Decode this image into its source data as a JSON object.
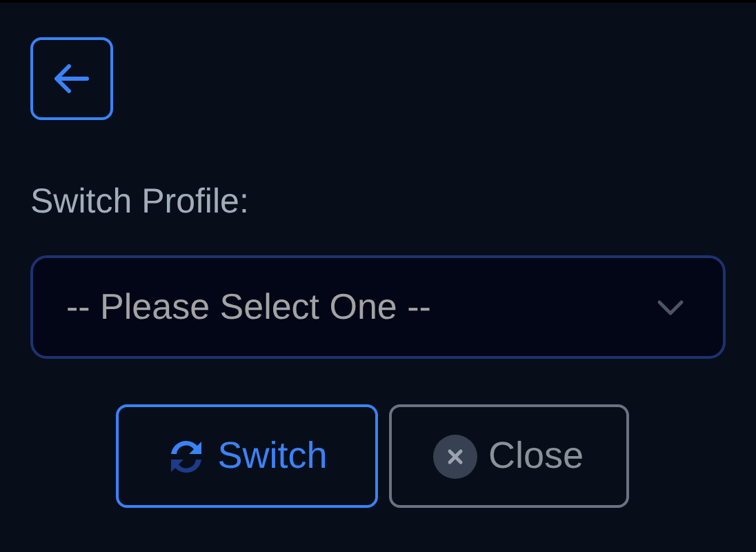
{
  "label": "Switch Profile:",
  "select": {
    "placeholder": "-- Please Select One --"
  },
  "buttons": [
    {
      "kind": "primary",
      "label": "Switch"
    },
    {
      "kind": "secondary",
      "label": "Close"
    }
  ]
}
